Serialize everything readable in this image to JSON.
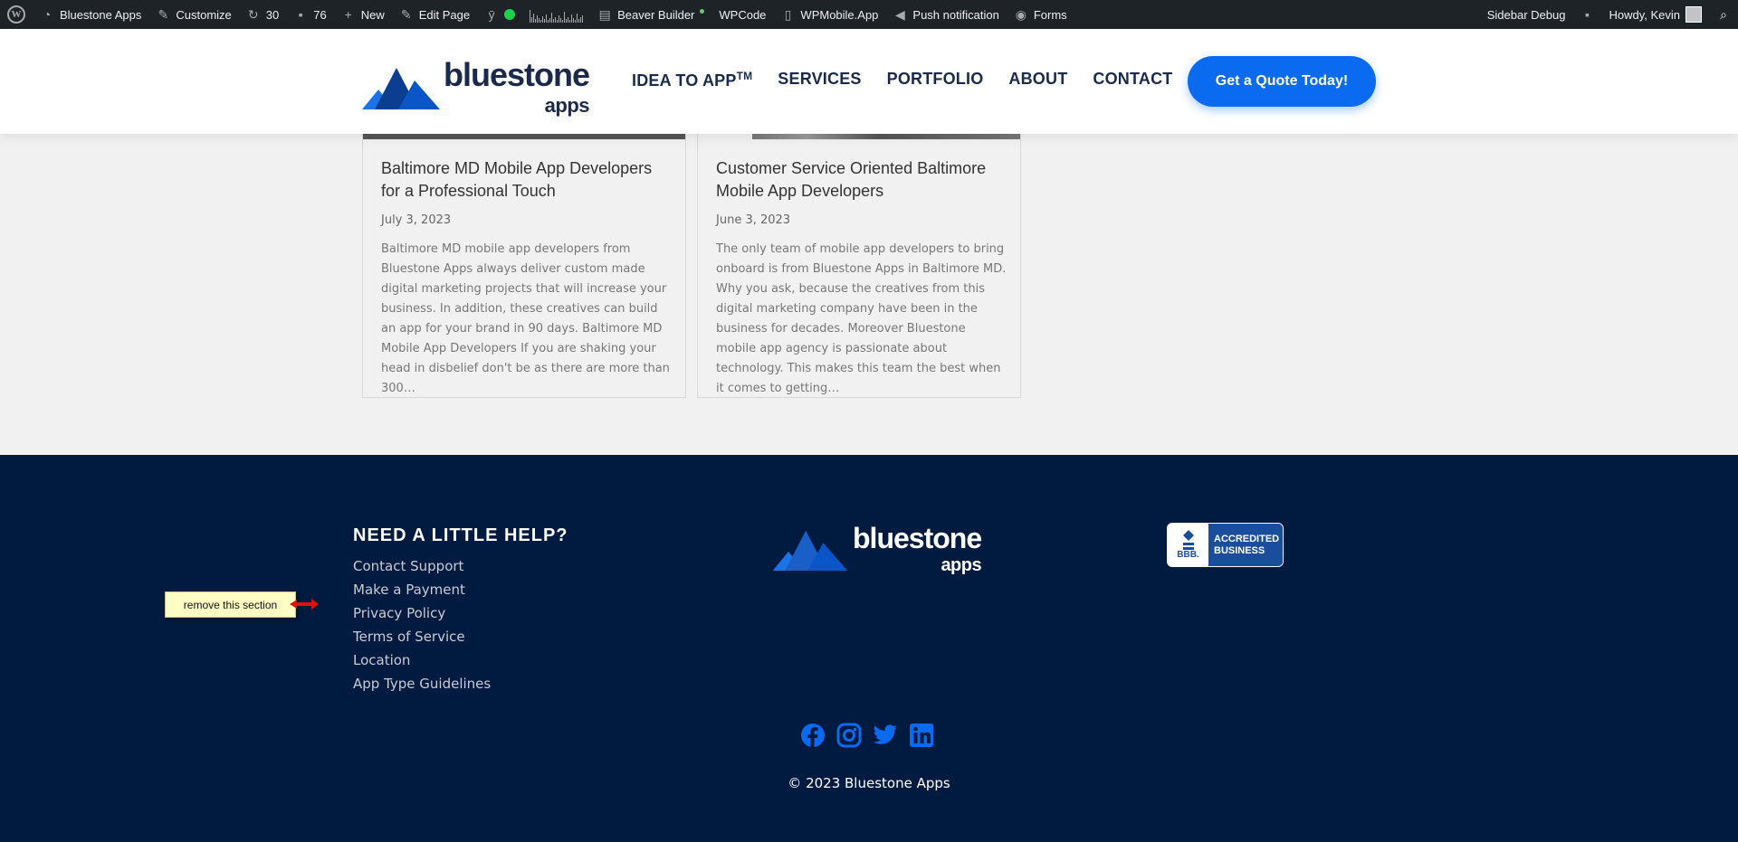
{
  "adminbar": {
    "site": "Bluestone Apps",
    "customize": "Customize",
    "updates": "30",
    "comments": "76",
    "new": "New",
    "edit_page": "Edit Page",
    "beaver": "Beaver Builder",
    "wpcode": "WPCode",
    "wpmobile": "WPMobile.App",
    "push": "Push notification",
    "forms": "Forms",
    "sidebar_debug": "Sidebar Debug",
    "howdy": "Howdy, Kevin"
  },
  "header": {
    "logo_main": "bluestone",
    "logo_sub": "apps",
    "nav": [
      "IDEA TO APP",
      "SERVICES",
      "PORTFOLIO",
      "ABOUT",
      "CONTACT"
    ],
    "nav_tm": "TM",
    "cta": "Get a Quote Today!"
  },
  "posts": [
    {
      "title": "Baltimore MD Mobile App Developers for a Professional Touch",
      "date": "July 3, 2023",
      "excerpt": "Baltimore MD mobile app developers from Bluestone Apps always deliver custom made digital marketing projects that will increase your business. In addition, these creatives can build an app for your brand in 90 days. Baltimore MD Mobile App Developers If you are shaking your head in disbelief don't be as there are more than 300…"
    },
    {
      "title": "Customer Service Oriented Baltimore Mobile App Developers",
      "date": "June 3, 2023",
      "excerpt": "The only team of mobile app developers to bring onboard is from Bluestone Apps in Baltimore MD. Why you ask, because the creatives from this digital marketing company have been in the business for decades. Moreover Bluestone mobile app agency is passionate about technology. This makes this team the best when it comes to getting…"
    }
  ],
  "footer": {
    "help_title": "NEED A LITTLE HELP?",
    "links": [
      "Contact Support",
      "Make a Payment",
      "Privacy Policy",
      "Terms of Service",
      "Location",
      "App Type Guidelines"
    ],
    "bbb_left": "BBB.",
    "bbb_line1": "ACCREDITED",
    "bbb_line2": "BUSINESS",
    "social_icons": [
      "facebook-icon",
      "instagram-icon",
      "twitter-icon",
      "linkedin-icon"
    ],
    "copyright": "© 2023 Bluestone Apps"
  },
  "annotation": {
    "note": "remove this section"
  },
  "colors": {
    "brand_blue": "#0a6af0",
    "navy": "#001a40",
    "adminbar": "#1d2327"
  }
}
